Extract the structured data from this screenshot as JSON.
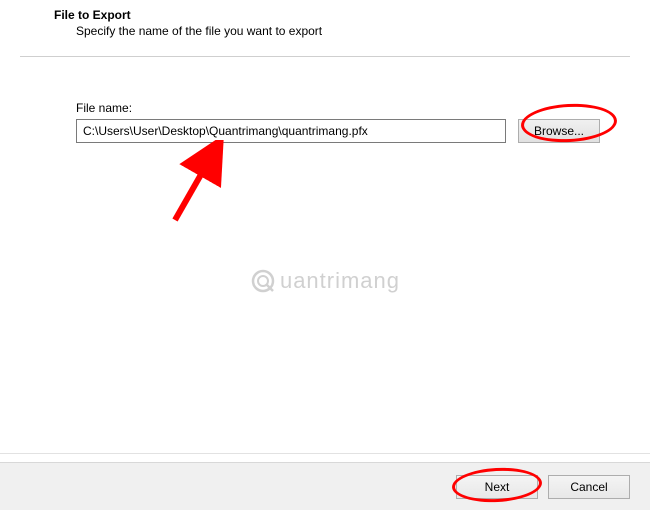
{
  "header": {
    "title": "File to Export",
    "subtitle": "Specify the name of the file you want to export"
  },
  "field": {
    "label": "File name:",
    "value": "C:\\Users\\User\\Desktop\\Quantrimang\\quantrimang.pfx",
    "browse_label": "Browse..."
  },
  "footer": {
    "next_label": "Next",
    "cancel_label": "Cancel"
  },
  "watermark": {
    "text": "uantrimang"
  },
  "annotations": {
    "arrow_color": "#ff0000",
    "ellipse_color": "#ff0000"
  }
}
